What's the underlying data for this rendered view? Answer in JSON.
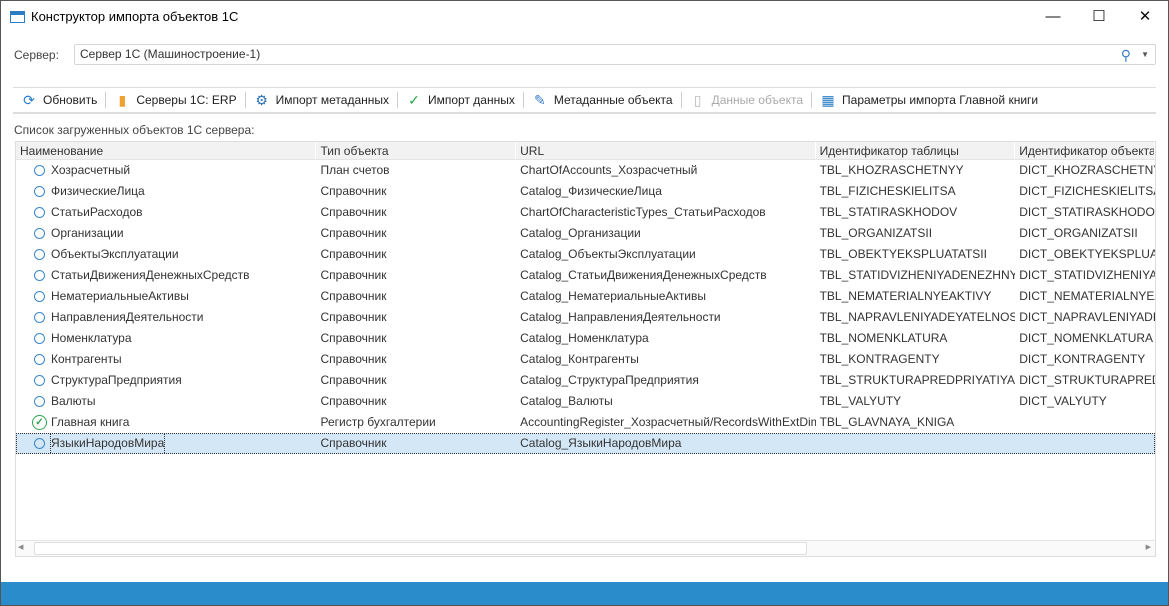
{
  "window": {
    "title": "Конструктор импорта объектов 1С",
    "minimize": "—",
    "maximize": "☐",
    "close": "✕"
  },
  "server": {
    "label": "Сервер:",
    "value": "Сервер 1С (Машиностроение-1)"
  },
  "toolbar": [
    {
      "label": "Обновить",
      "icon": "refresh-icon",
      "glyph": "⟳",
      "color": "#2a7fc4",
      "disabled": false
    },
    {
      "label": "Серверы 1С: ERP",
      "icon": "database-icon",
      "glyph": "▮",
      "color": "#f0a030",
      "disabled": false
    },
    {
      "label": "Импорт метаданных",
      "icon": "gear-icon",
      "glyph": "⚙",
      "color": "#2a6fb4",
      "disabled": false
    },
    {
      "label": "Импорт данных",
      "icon": "check-circle-icon",
      "glyph": "✓",
      "color": "#2ea44f",
      "disabled": false
    },
    {
      "label": "Метаданные объекта",
      "icon": "pencil-icon",
      "glyph": "✎",
      "color": "#3a7dc9",
      "disabled": false
    },
    {
      "label": "Данные объекта",
      "icon": "document-icon",
      "glyph": "▯",
      "color": "#bbb",
      "disabled": true
    },
    {
      "label": "Параметры импорта Главной книги",
      "icon": "ledger-icon",
      "glyph": "▦",
      "color": "#2a7fc4",
      "disabled": false
    }
  ],
  "list_label": "Список загруженных объектов 1С сервера:",
  "columns": [
    "Наименование",
    "Тип объекта",
    "URL",
    "Идентификатор таблицы",
    "Идентификатор объекта"
  ],
  "rows": [
    {
      "status": "pending",
      "name": "Хозрасчетный",
      "type": "План счетов",
      "url": "ChartOfAccounts_Хозрасчетный",
      "tbl": "TBL_KHOZRASCHETNYY",
      "dict": "DICT_KHOZRASCHETNYY"
    },
    {
      "status": "pending",
      "name": "ФизическиеЛица",
      "type": "Справочник",
      "url": "Catalog_ФизическиеЛица",
      "tbl": "TBL_FIZICHESKIELITSA",
      "dict": "DICT_FIZICHESKIELITSA"
    },
    {
      "status": "pending",
      "name": "СтатьиРасходов",
      "type": "Справочник",
      "url": "ChartOfCharacteristicTypes_СтатьиРасходов",
      "tbl": "TBL_STATIRASKHODOV",
      "dict": "DICT_STATIRASKHODOV"
    },
    {
      "status": "pending",
      "name": "Организации",
      "type": "Справочник",
      "url": "Catalog_Организации",
      "tbl": "TBL_ORGANIZATSII",
      "dict": "DICT_ORGANIZATSII"
    },
    {
      "status": "pending",
      "name": "ОбъектыЭксплуатации",
      "type": "Справочник",
      "url": "Catalog_ОбъектыЭксплуатации",
      "tbl": "TBL_OBEKTYEKSPLUATATSII",
      "dict": "DICT_OBEKTYEKSPLUATATSII"
    },
    {
      "status": "pending",
      "name": "СтатьиДвиженияДенежныхСредств",
      "type": "Справочник",
      "url": "Catalog_СтатьиДвиженияДенежныхСредств",
      "tbl": "TBL_STATIDVIZHENIYADENEZHNYKHSR",
      "dict": "DICT_STATIDVIZHENIYADENEZHNYKHSR"
    },
    {
      "status": "pending",
      "name": "НематериальныеАктивы",
      "type": "Справочник",
      "url": "Catalog_НематериальныеАктивы",
      "tbl": "TBL_NEMATERIALNYEAKTIVY",
      "dict": "DICT_NEMATERIALNYEAKTIVY"
    },
    {
      "status": "pending",
      "name": "НаправленияДеятельности",
      "type": "Справочник",
      "url": "Catalog_НаправленияДеятельности",
      "tbl": "TBL_NAPRAVLENIYADEYATELNOSTI",
      "dict": "DICT_NAPRAVLENIYADEYATELNOSTI"
    },
    {
      "status": "pending",
      "name": "Номенклатура",
      "type": "Справочник",
      "url": "Catalog_Номенклатура",
      "tbl": "TBL_NOMENKLATURA",
      "dict": "DICT_NOMENKLATURA"
    },
    {
      "status": "pending",
      "name": "Контрагенты",
      "type": "Справочник",
      "url": "Catalog_Контрагенты",
      "tbl": "TBL_KONTRAGENTY",
      "dict": "DICT_KONTRAGENTY"
    },
    {
      "status": "pending",
      "name": "СтруктураПредприятия",
      "type": "Справочник",
      "url": "Catalog_СтруктураПредприятия",
      "tbl": "TBL_STRUKTURAPREDPRIYATIYA",
      "dict": "DICT_STRUKTURAPREDPRIYATIYA"
    },
    {
      "status": "pending",
      "name": "Валюты",
      "type": "Справочник",
      "url": "Catalog_Валюты",
      "tbl": "TBL_VALYUTY",
      "dict": "DICT_VALYUTY"
    },
    {
      "status": "imported",
      "name": "Главная книга",
      "type": "Регистр бухгалтерии",
      "url": "AccountingRegister_Хозрасчетный/RecordsWithExtDimensions",
      "tbl": "TBL_GLAVNAYA_KNIGA",
      "dict": ""
    },
    {
      "status": "pending",
      "name": "ЯзыкиНародовМира",
      "type": "Справочник",
      "url": "Catalog_ЯзыкиНародовМира",
      "tbl": "",
      "dict": "",
      "selected": true
    }
  ]
}
